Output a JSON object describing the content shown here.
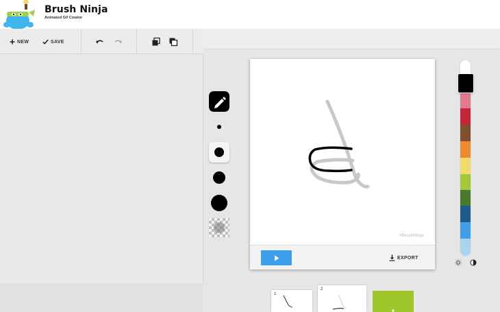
{
  "app": {
    "title": "Brush Ninja",
    "subtitle": "Animated Gif Creator"
  },
  "toolbar": {
    "new_label": "NEW",
    "save_label": "SAVE",
    "icons": [
      "plus-icon",
      "check-icon",
      "undo-icon",
      "redo-icon",
      "copy-frame-icon",
      "paste-frame-icon"
    ]
  },
  "brush": {
    "sizes": [
      "tiny",
      "small",
      "medium",
      "large"
    ],
    "selected_size": "small",
    "tool": "pencil"
  },
  "canvas": {
    "watermark": "#BrushNinja",
    "export_label": "EXPORT"
  },
  "palette": {
    "selected": "#000000",
    "colors": [
      "#ffffff",
      "#e47a8f",
      "#c5243a",
      "#824f2e",
      "#ef8a30",
      "#f1d96b",
      "#a3c83a",
      "#4a7a2e",
      "#1e5a8c",
      "#3e9fec",
      "#a8d4ef"
    ]
  },
  "timeline": {
    "frames": [
      {
        "number": "1"
      },
      {
        "number": "2"
      }
    ],
    "add_color": "#9fc72b"
  },
  "colors": {
    "accent_blue": "#3e9fec",
    "accent_green": "#9fc72b"
  }
}
